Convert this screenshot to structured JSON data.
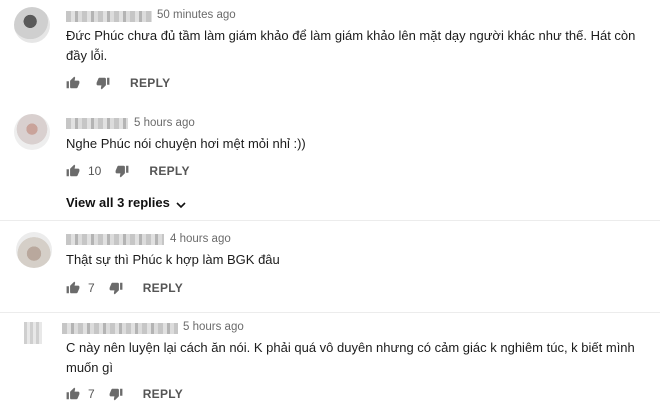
{
  "comments": [
    {
      "time": "50 minutes ago",
      "text": "Đức Phúc chưa đủ tầm làm giám khảo để làm giám khảo lên mặt dạy người khác như thế. Hát còn đầy lỗi.",
      "likes": "",
      "reply_label": "REPLY"
    },
    {
      "time": "5 hours ago",
      "text": "Nghe Phúc nói chuyện hơi mệt mỏi nhỉ :))",
      "likes": "10",
      "reply_label": "REPLY",
      "view_replies": "View all 3 replies"
    },
    {
      "time": "4 hours ago",
      "text": "Thật sự thì Phúc k hợp làm BGK đâu",
      "likes": "7",
      "reply_label": "REPLY"
    },
    {
      "time": "5 hours ago",
      "text": "C này nên luyện lại cách ăn nói. K phải quá vô duyên nhưng có cảm giác k nghiêm túc, k biết mình muốn gì",
      "likes": "7",
      "reply_label": "REPLY"
    }
  ],
  "icons": {
    "like": "thumbs-up-icon",
    "dislike": "thumbs-down-icon",
    "expand": "chevron-down-icon"
  },
  "colors": {
    "meta": "#6b6b6b",
    "action": "#555555",
    "text": "#1c1c1c"
  }
}
